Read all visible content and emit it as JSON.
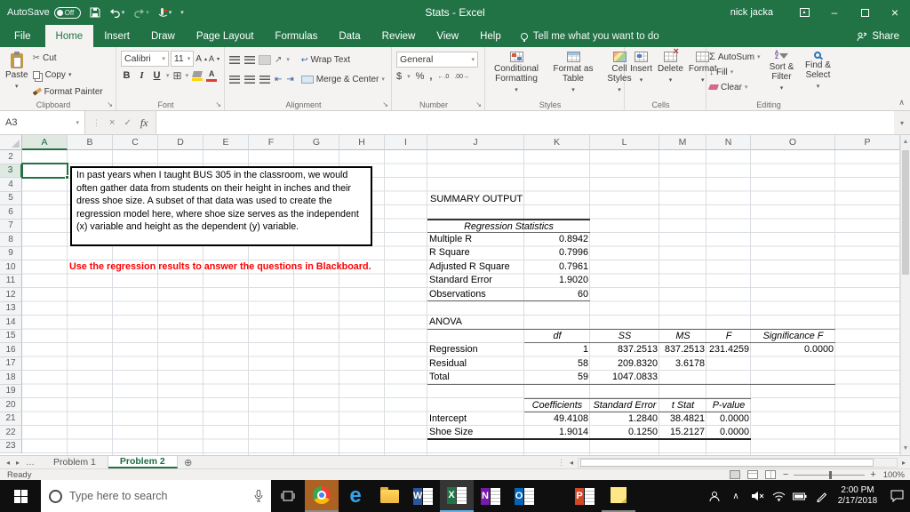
{
  "titlebar": {
    "autosave_label": "AutoSave",
    "autosave_state": "Off",
    "title": "Stats - Excel",
    "user": "nick jacka"
  },
  "tabs": {
    "items": [
      "File",
      "Home",
      "Insert",
      "Draw",
      "Page Layout",
      "Formulas",
      "Data",
      "Review",
      "View",
      "Help"
    ],
    "active": "Home",
    "tell_me": "Tell me what you want to do",
    "share": "Share"
  },
  "ribbon": {
    "clipboard": {
      "label": "Clipboard",
      "paste": "Paste",
      "cut": "Cut",
      "copy": "Copy",
      "format_painter": "Format Painter"
    },
    "font": {
      "label": "Font",
      "font_name": "Calibri",
      "font_size": "11"
    },
    "alignment": {
      "label": "Alignment",
      "wrap_text": "Wrap Text",
      "merge_center": "Merge & Center"
    },
    "number": {
      "label": "Number",
      "format": "General"
    },
    "styles": {
      "label": "Styles",
      "conditional_formatting": "Conditional Formatting",
      "format_as_table": "Format as Table",
      "cell_styles": "Cell Styles"
    },
    "cells": {
      "label": "Cells",
      "insert": "Insert",
      "delete": "Delete",
      "format": "Format"
    },
    "editing": {
      "label": "Editing",
      "autosum": "AutoSum",
      "fill": "Fill",
      "clear": "Clear",
      "sort_filter": "Sort & Filter",
      "find_select": "Find & Select"
    }
  },
  "formula_bar": {
    "name_box": "A3",
    "fx": "fx",
    "value": ""
  },
  "grid": {
    "columns": [
      "A",
      "B",
      "C",
      "D",
      "E",
      "F",
      "G",
      "H",
      "I",
      "J",
      "K",
      "L",
      "M",
      "N",
      "O",
      "P"
    ],
    "rows": [
      "2",
      "3",
      "4",
      "5",
      "6",
      "7",
      "8",
      "9",
      "10",
      "11",
      "12",
      "13",
      "14",
      "15",
      "16",
      "17",
      "18",
      "19",
      "20",
      "21",
      "22",
      "23"
    ],
    "selected_cell": "A3",
    "note_text": "In past years when I taught BUS 305 in the classroom, we would often gather data from students on their height in inches and their dress shoe size. A subset of that data was used to create the regression model here, where shoe size serves as the independent (x) variable and height as the dependent (y) variable.",
    "red_note": "Use the regression results to answer the questions in Blackboard.",
    "summary_title": "SUMMARY OUTPUT",
    "regression_stats": {
      "title": "Regression Statistics",
      "rows": [
        [
          "Multiple R",
          "0.8942"
        ],
        [
          "R Square",
          "0.7996"
        ],
        [
          "Adjusted R Square",
          "0.7961"
        ],
        [
          "Standard Error",
          "1.9020"
        ],
        [
          "Observations",
          "60"
        ]
      ]
    },
    "anova": {
      "title": "ANOVA",
      "headers": [
        "df",
        "SS",
        "MS",
        "F",
        "Significance F"
      ],
      "rows": [
        [
          "Regression",
          "1",
          "837.2513",
          "837.2513",
          "231.4259",
          "0.0000"
        ],
        [
          "Residual",
          "58",
          "209.8320",
          "3.6178",
          "",
          ""
        ],
        [
          "Total",
          "59",
          "1047.0833",
          "",
          "",
          ""
        ]
      ]
    },
    "coefficients": {
      "headers": [
        "Coefficients",
        "Standard Error",
        "t Stat",
        "P-value"
      ],
      "rows": [
        [
          "Intercept",
          "49.4108",
          "1.2840",
          "38.4821",
          "0.0000"
        ],
        [
          "Shoe Size",
          "1.9014",
          "0.1250",
          "15.2127",
          "0.0000"
        ]
      ]
    }
  },
  "sheet_tabs": {
    "items": [
      "Problem 1",
      "Problem 2"
    ],
    "active": "Problem 2",
    "more_indicator": "…"
  },
  "status_bar": {
    "mode": "Ready",
    "zoom": "100%"
  },
  "taskbar": {
    "search_placeholder": "Type here to search",
    "time": "2:00 PM",
    "date": "2/17/2018"
  },
  "colors": {
    "excel_green": "#217346",
    "red_note": "#FF0000",
    "taskbar": "#0F0F0F",
    "active_underline": "#5FB2E8"
  }
}
